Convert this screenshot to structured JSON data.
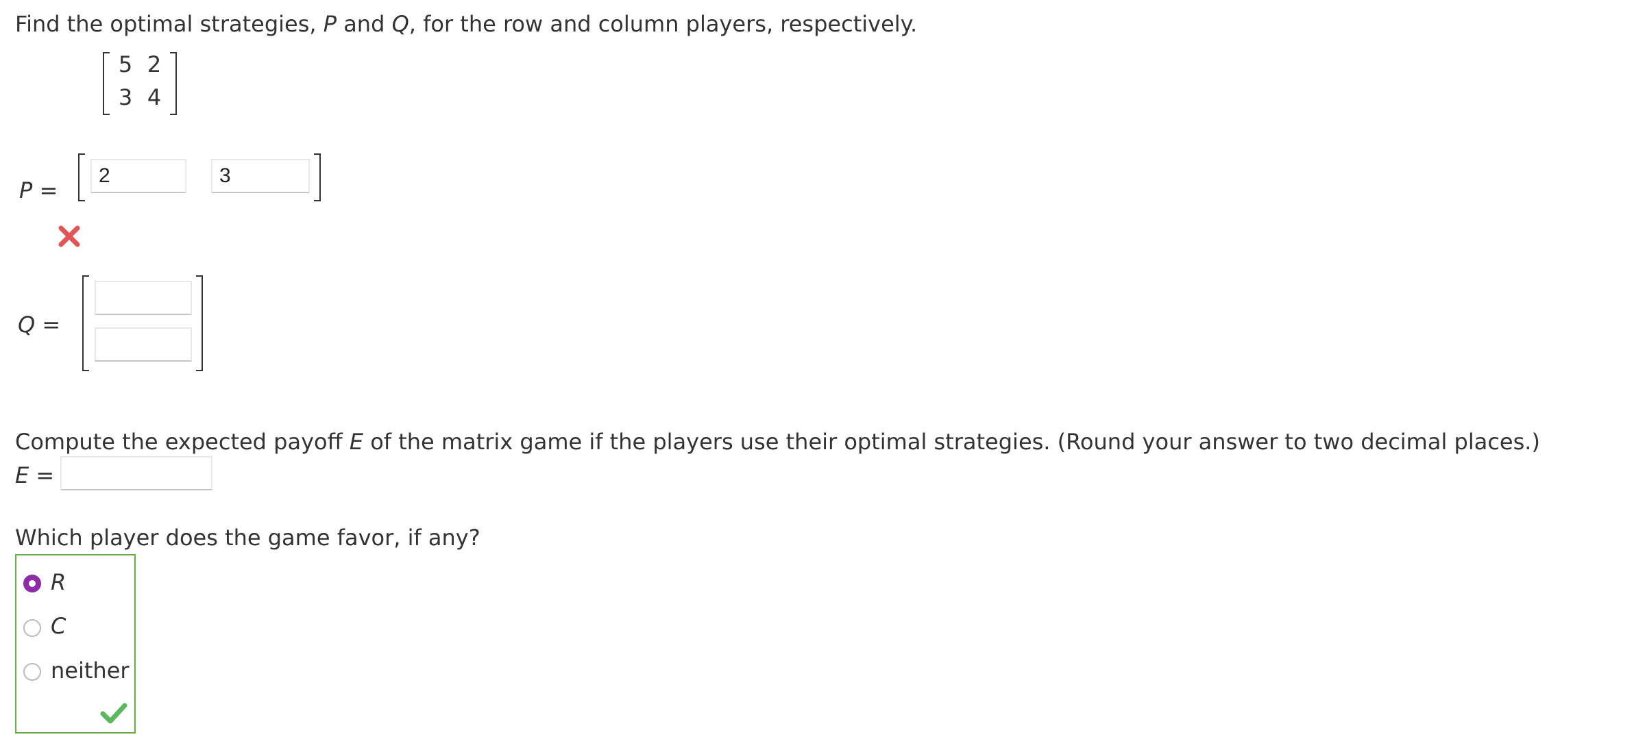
{
  "q1": {
    "prefix": "Find the optimal strategies, ",
    "p_symbol": "P",
    "and_text": " and ",
    "q_symbol": "Q",
    "suffix": ", for the row and column players, respectively."
  },
  "matrix": {
    "rows": [
      [
        "5",
        "2"
      ],
      [
        "3",
        "4"
      ]
    ]
  },
  "p_answer": {
    "label_var": "P",
    "label_eq": " =",
    "values": [
      "2",
      "3"
    ],
    "status": "incorrect"
  },
  "q_answer": {
    "label_var": "Q",
    "label_eq": " =",
    "values": [
      "",
      ""
    ]
  },
  "q2": {
    "prefix": "Compute the expected payoff ",
    "e_symbol": "E",
    "suffix": " of the matrix game if the players use their optimal strategies. (Round your answer to two decimal places.)",
    "label_var": "E",
    "label_eq": " =",
    "value": ""
  },
  "q3": {
    "question": "Which player does the game favor, if any?",
    "options": [
      "R",
      "C",
      "neither"
    ],
    "selected": "R",
    "status": "correct"
  },
  "colors": {
    "radio_selected": "#8e2ca8",
    "incorrect": "#e05555",
    "correct": "#5cb85c",
    "answer_box_border": "#6aaa48"
  },
  "icons": {
    "incorrect": "x-mark-icon",
    "correct": "checkmark-icon"
  }
}
